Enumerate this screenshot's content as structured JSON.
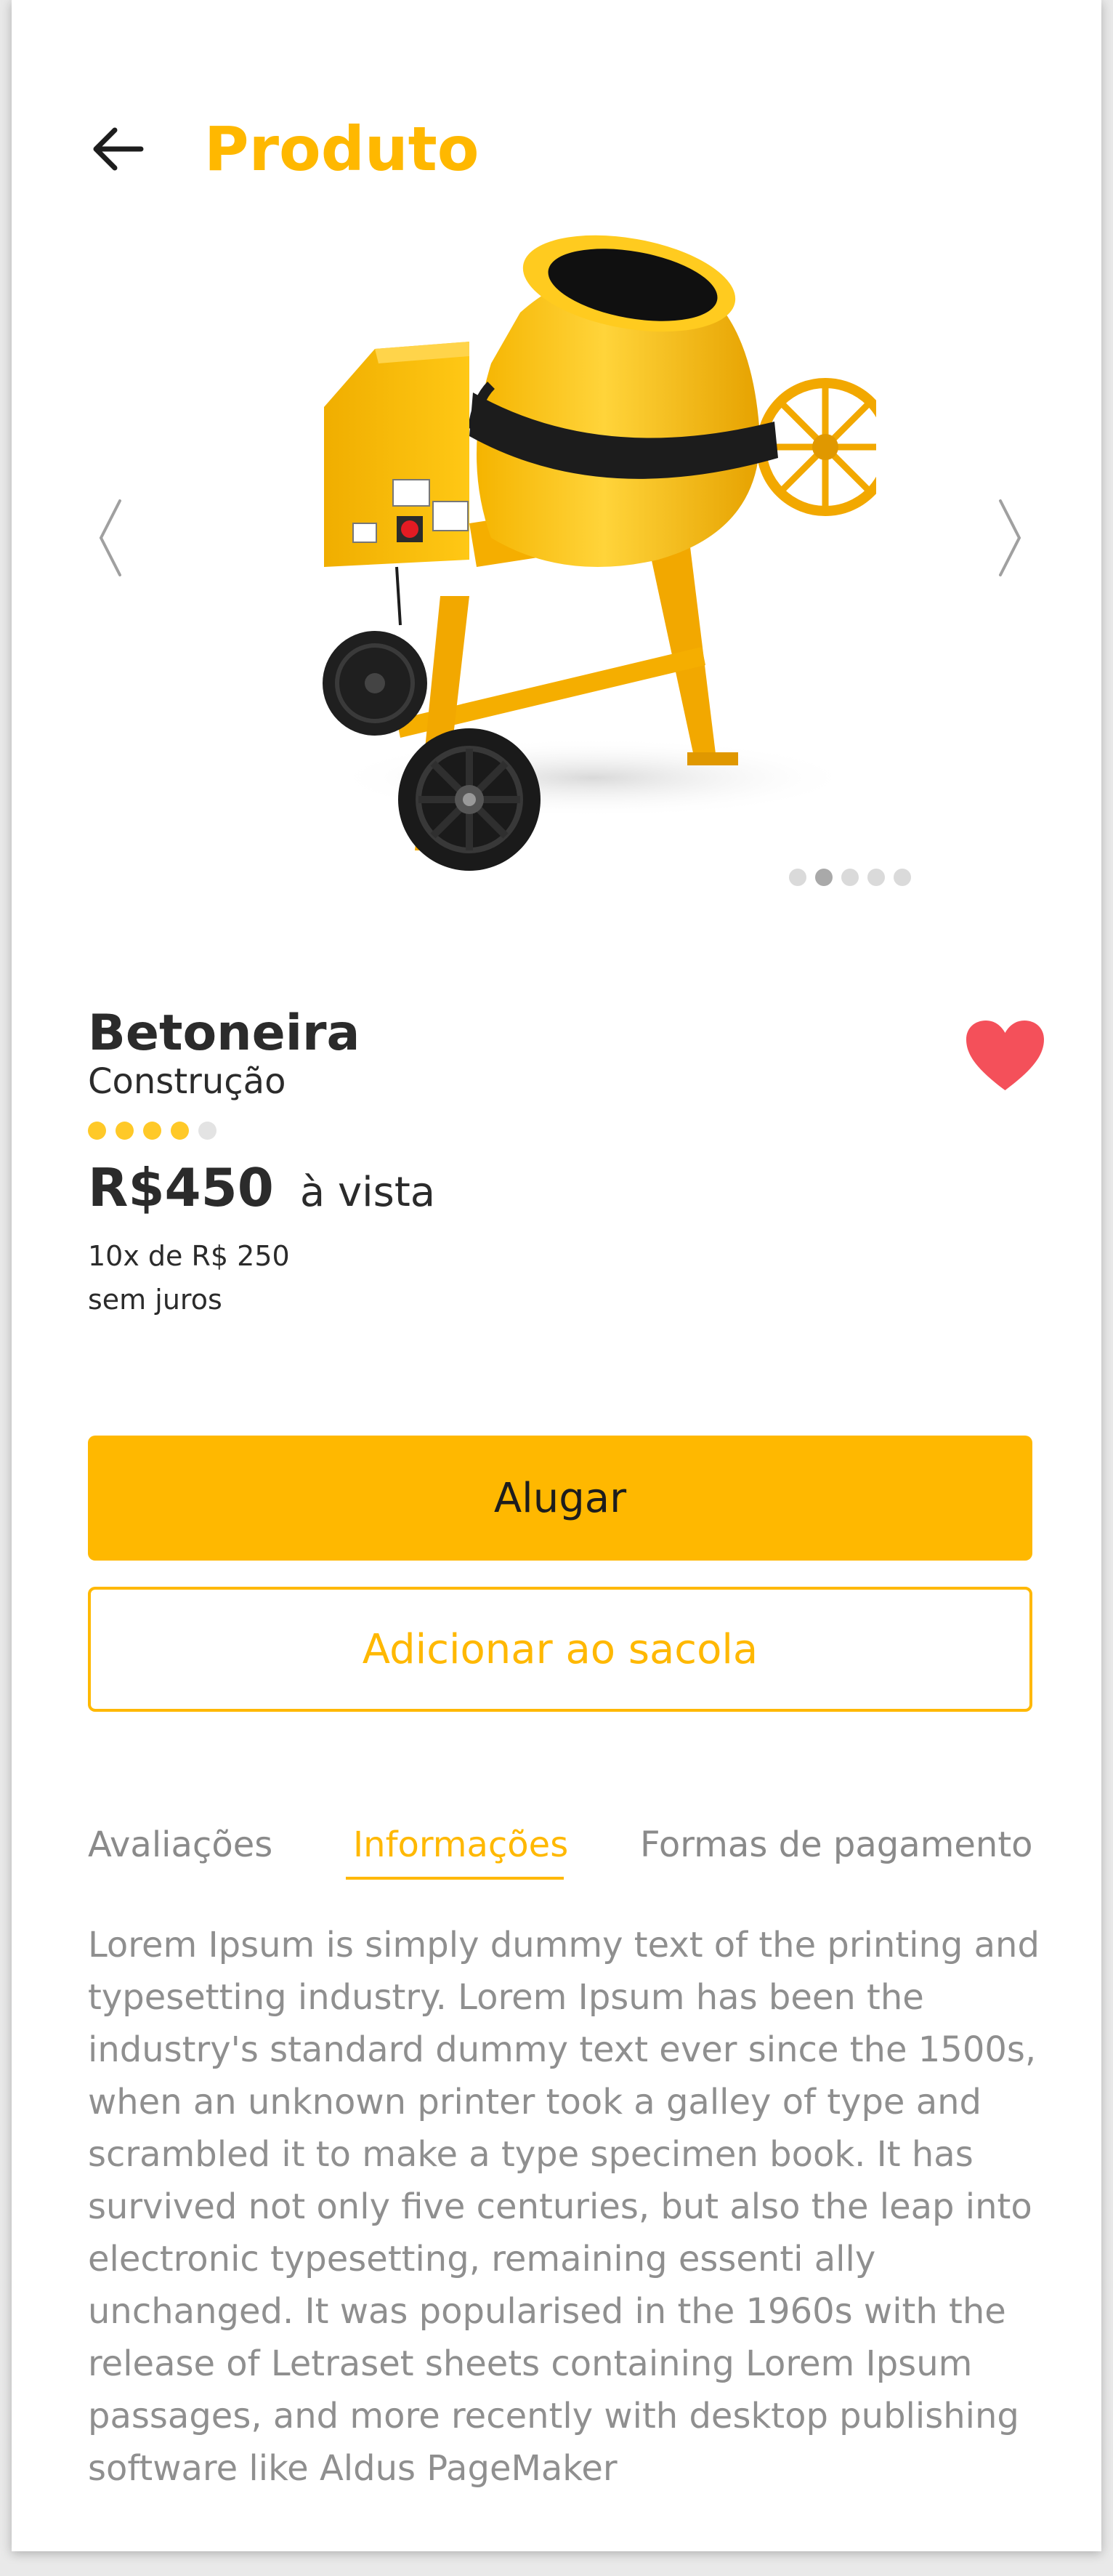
{
  "header": {
    "title": "Produto",
    "back_icon": "arrow-left-icon"
  },
  "gallery": {
    "prev_icon": "chevron-left-icon",
    "next_icon": "chevron-right-icon",
    "image_name": "cement-mixer",
    "dots_count": 5,
    "active_dot_index": 1
  },
  "product": {
    "name": "Betoneira",
    "category": "Construção",
    "rating": 4,
    "rating_max": 5,
    "price": "R$450",
    "price_mode": "à vista",
    "installments_line1": "10x de R$ 250",
    "installments_line2": "sem juros",
    "favorite": true
  },
  "actions": {
    "primary_label": "Alugar",
    "secondary_label": "Adicionar ao sacola"
  },
  "tabs": [
    {
      "label": "Avaliações",
      "active": false
    },
    {
      "label": "Informações",
      "active": true
    },
    {
      "label": "Formas de pagamento",
      "active": false
    }
  ],
  "description": "Lorem Ipsum is simply dummy text of the printing and typesetting industry. Lorem Ipsum has been the industry's standard dummy text ever since the 1500s, when an unknown printer took a galley of type and scrambled it to make a type specimen book. It has survived not only five centuries, but also the leap into electronic typesetting, remaining essenti  ally unchanged. It was popularised in the 1960s with the release of Letraset sheets containing Lorem Ipsum passages, and more recently with desktop publishing software like Aldus PageMaker",
  "colors": {
    "accent": "#FFB800",
    "heart": "#F4505A",
    "text_dark": "#2B2B2B",
    "text_muted": "#8F8F8F"
  }
}
